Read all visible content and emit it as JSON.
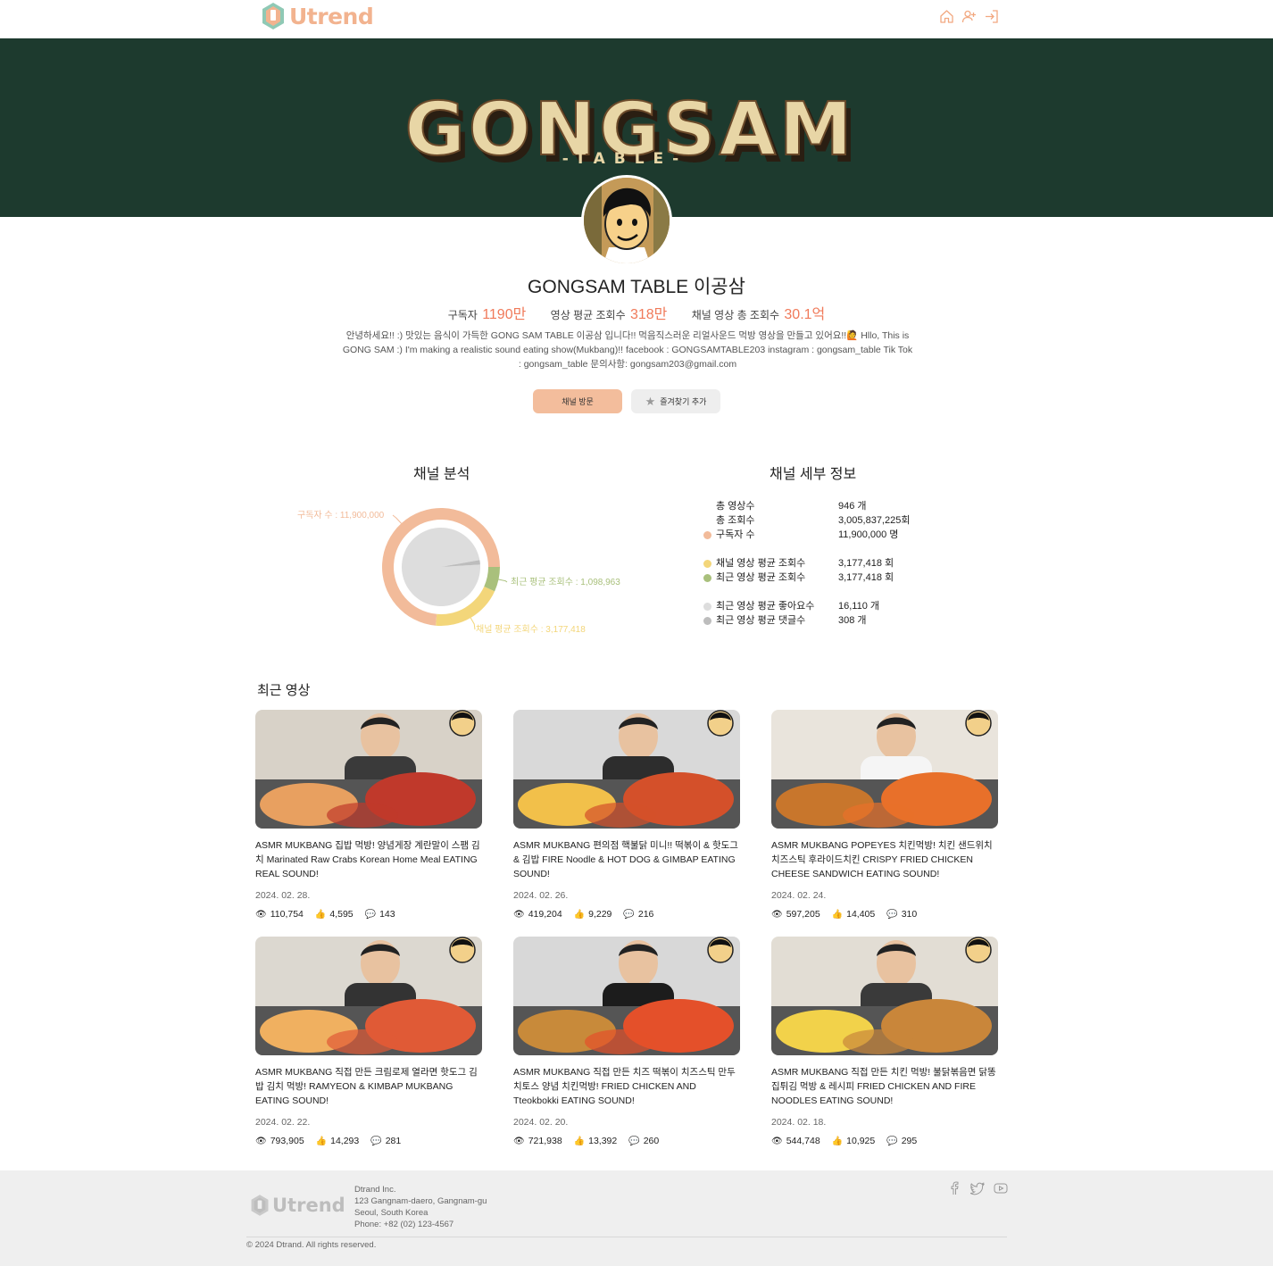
{
  "header": {
    "logo_text": "Utrend",
    "nav_icons": [
      "home-icon",
      "user-plus-icon",
      "login-icon"
    ]
  },
  "banner": {
    "title_text": "GONGSAM",
    "subtitle_text": "-TABLE-"
  },
  "channel": {
    "name": "GONGSAM TABLE 이공삼",
    "subscribers_label": "구독자",
    "subscribers_value": "1190만",
    "avg_views_label": "영상 평균 조회수",
    "avg_views_value": "318만",
    "total_views_label": "채널 영상 총 조회수",
    "total_views_value": "30.1억",
    "description": "안녕하세요!! :) 맛있는 음식이 가득한 GONG SAM TABLE 이공삼 입니다!! 먹음직스러운 리얼사운드 먹방 영상을 만들고 있어요!!🙋 Hllo, This is GONG SAM :) I'm making a realistic sound eating show(Mukbang)!! facebook : GONGSAMTABLE203 instagram : gongsam_table Tik Tok : gongsam_table 문의사항: gongsam203@gmail.com",
    "visit_button": "채널 방문",
    "favorite_button": "즐겨찾기 추가"
  },
  "analysis": {
    "title": "채널 분석"
  },
  "chart_data": {
    "type": "pie",
    "categories": [
      "구독자 수",
      "채널 평균 조회수",
      "최근 평균 조회수"
    ],
    "values": [
      11900000,
      3177418,
      1098963
    ],
    "labels": [
      "구독자 수 : 11,900,000",
      "채널 평균 조회수 : 3,177,418",
      "최근 평균 조회수 : 1,098,963"
    ],
    "colors": [
      "#f2bb9a",
      "#f3d67a",
      "#a9c07c"
    ],
    "inner_pie": {
      "values": [
        16110,
        308
      ],
      "colors": [
        "#dddddd",
        "#bdbdbd"
      ]
    }
  },
  "details": {
    "title": "채널 세부 정보",
    "rows": [
      {
        "label": "총 영상수",
        "value": "946 개",
        "color": ""
      },
      {
        "label": "총 조회수",
        "value": "3,005,837,225회",
        "color": ""
      },
      {
        "label": "구독자 수",
        "value": "11,900,000 명",
        "color": "#f2bb9a"
      },
      {
        "label": "채널 영상 평균 조회수",
        "value": "3,177,418 회",
        "color": "#f3d67a"
      },
      {
        "label": "최근 영상 평균 조회수",
        "value": "3,177,418 회",
        "color": "#a9c07c"
      },
      {
        "label": "최근 영상 평균 좋아요수",
        "value": "16,110 개",
        "color": "#dddddd"
      },
      {
        "label": "최근 영상 평균 댓글수",
        "value": "308 개",
        "color": "#bdbdbd"
      }
    ]
  },
  "recent": {
    "title": "최근 영상",
    "videos": [
      {
        "title": "ASMR MUKBANG 집밥 먹방! 양념게장 계란말이 스팸 김치 Marinated Raw Crabs Korean Home Meal EATING REAL SOUND!",
        "date": "2024. 02. 28.",
        "views": "110,754",
        "likes": "4,595",
        "comments": "143"
      },
      {
        "title": "ASMR MUKBANG 편의점 핵불닭 미니!! 떡볶이 & 핫도그 & 김밥 FIRE Noodle & HOT DOG & GIMBAP EATING SOUND!",
        "date": "2024. 02. 26.",
        "views": "419,204",
        "likes": "9,229",
        "comments": "216"
      },
      {
        "title": "ASMR MUKBANG POPEYES 치킨먹방! 치킨 샌드위치 치즈스틱 후라이드치킨 CRISPY FRIED CHICKEN CHEESE SANDWICH EATING SOUND!",
        "date": "2024. 02. 24.",
        "views": "597,205",
        "likes": "14,405",
        "comments": "310"
      },
      {
        "title": "ASMR MUKBANG 직접 만든 크림로제 열라면 핫도그 김밥 김치 먹방! RAMYEON & KIMBAP MUKBANG EATING SOUND!",
        "date": "2024. 02. 22.",
        "views": "793,905",
        "likes": "14,293",
        "comments": "281"
      },
      {
        "title": "ASMR MUKBANG 직접 만든 치즈 떡볶이 치즈스틱 만두 치토스 양념 치킨먹방! FRIED CHICKEN AND Tteokbokki EATING SOUND!",
        "date": "2024. 02. 20.",
        "views": "721,938",
        "likes": "13,392",
        "comments": "260"
      },
      {
        "title": "ASMR MUKBANG 직접 만든 치킨 먹방! 불닭볶음면 닭똥집튀김 먹방 & 레시피 FRIED CHICKEN AND FIRE NOODLES EATING SOUND!",
        "date": "2024. 02. 18.",
        "views": "544,748",
        "likes": "10,925",
        "comments": "295"
      }
    ]
  },
  "footer": {
    "logo_text": "Utrend",
    "company": "Dtrand Inc.",
    "address1": "123 Gangnam-daero, Gangnam-gu",
    "address2": "Seoul, South Korea",
    "phone": "Phone: +82 (02) 123-4567",
    "copyright": "© 2024 Dtrand. All rights reserved.",
    "social_icons": [
      "facebook-icon",
      "twitter-icon",
      "youtube-icon"
    ]
  }
}
